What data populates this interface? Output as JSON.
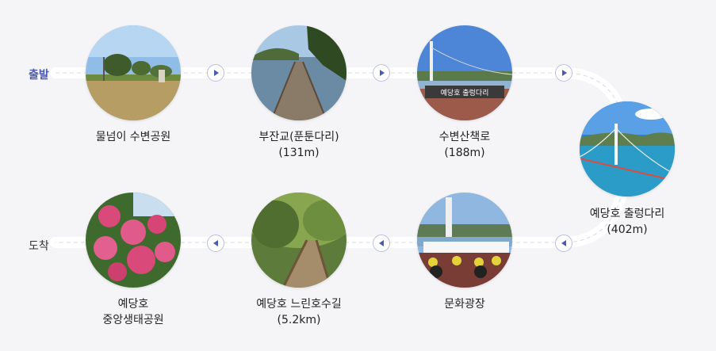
{
  "start_label": "출발",
  "end_label": "도착",
  "stops": [
    {
      "name": "물넘이 수변공원",
      "distance": ""
    },
    {
      "name": "부잔교(푼툰다리)",
      "distance": "(131m)"
    },
    {
      "name": "수변산책로",
      "distance": "(188m)"
    },
    {
      "name": "예당호 출렁다리",
      "distance": "(402m)"
    },
    {
      "name": "문화광장",
      "distance": ""
    },
    {
      "name": "예당호 느린호수길",
      "distance": "(5.2km)"
    },
    {
      "name": "예당호",
      "distance": "중앙생태공원"
    }
  ],
  "photo_sign_text": "예당호 출렁다리",
  "colors": {
    "accent": "#4a5bb5",
    "track": "#ffffff",
    "background": "#f5f5f7"
  }
}
